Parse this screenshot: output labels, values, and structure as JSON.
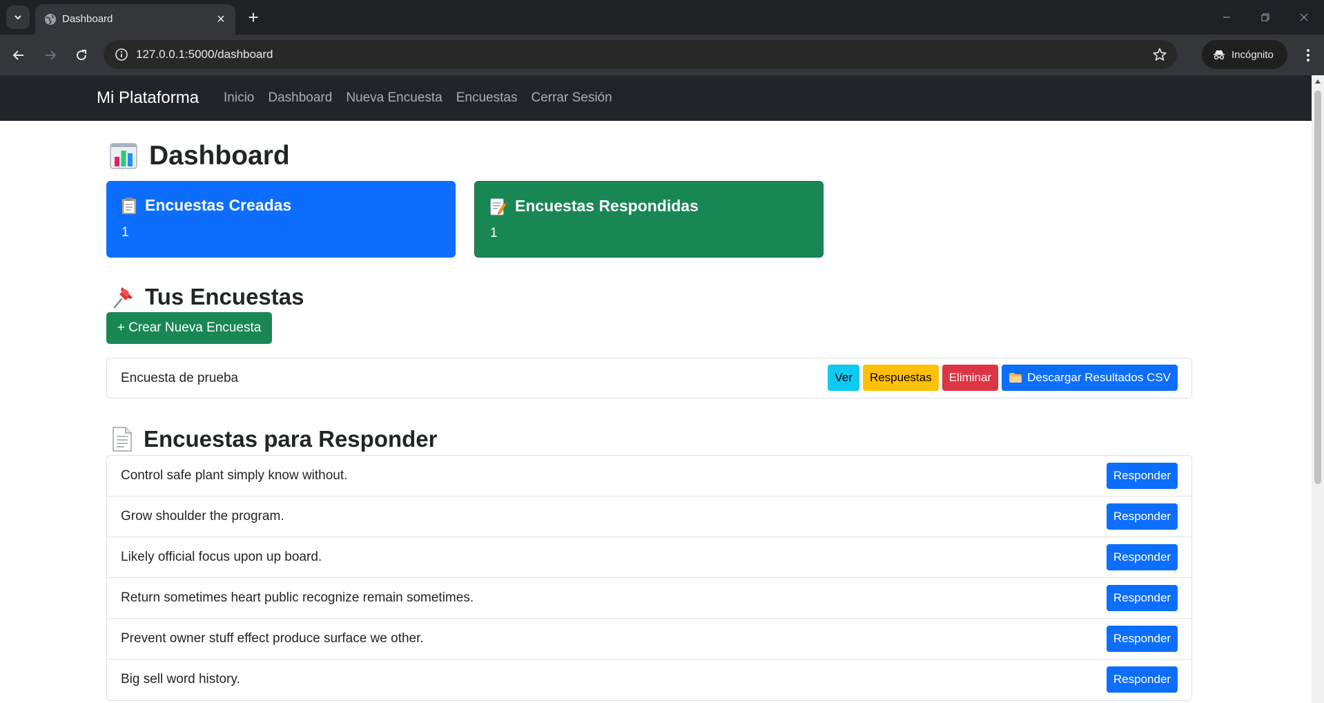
{
  "browser": {
    "tab_title": "Dashboard",
    "url": "127.0.0.1:5000/dashboard",
    "profile_label": "Incógnito"
  },
  "navbar": {
    "brand": "Mi Plataforma",
    "links": [
      "Inicio",
      "Dashboard",
      "Nueva Encuesta",
      "Encuestas",
      "Cerrar Sesión"
    ]
  },
  "dashboard": {
    "title": "Dashboard",
    "stats": [
      {
        "label": "Encuestas Creadas",
        "value": "1",
        "color": "#0d6efd"
      },
      {
        "label": "Encuestas Respondidas",
        "value": "1",
        "color": "#198754"
      }
    ]
  },
  "own_surveys": {
    "heading": "Tus Encuestas",
    "create_button": "+ Crear Nueva Encuesta",
    "items": [
      {
        "title": "Encuesta de prueba",
        "actions": {
          "view": "Ver",
          "responses": "Respuestas",
          "delete": "Eliminar",
          "download": "Descargar Resultados CSV"
        }
      }
    ]
  },
  "to_answer": {
    "heading": "Encuestas para Responder",
    "button_label": "Responder",
    "items": [
      "Control safe plant simply know without.",
      "Grow shoulder the program.",
      "Likely official focus upon up board.",
      "Return sometimes heart public recognize remain sometimes.",
      "Prevent owner stuff effect produce surface we other.",
      "Big sell word history."
    ]
  },
  "icons": {
    "dashboard": "bar-chart-icon",
    "created": "clipboard-icon",
    "answered": "memo-icon",
    "own": "pushpin-icon",
    "to_answer": "page-icon",
    "download": "folder-icon"
  }
}
